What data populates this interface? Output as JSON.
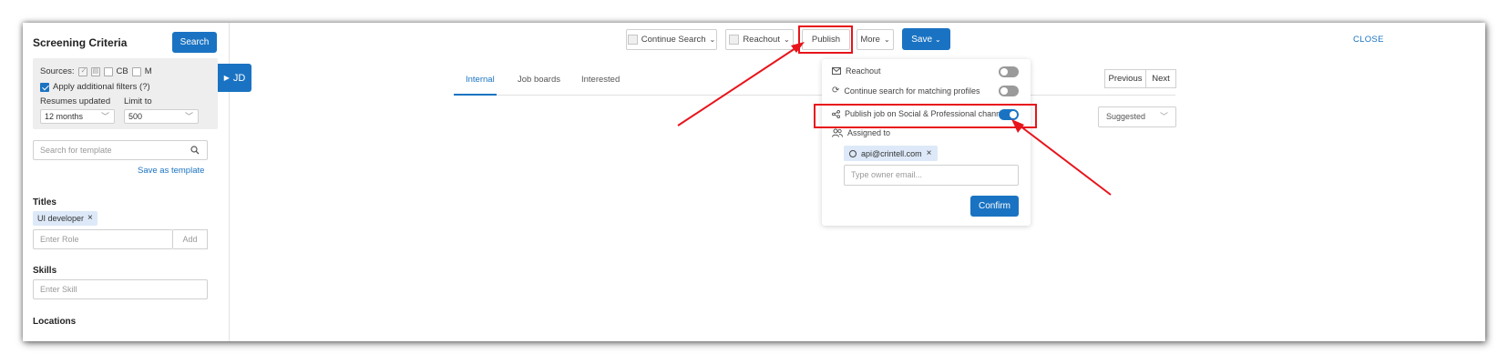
{
  "sidebar": {
    "title": "Screening Criteria",
    "search_button": "Search",
    "sources_label": "Sources:",
    "source_cb": "CB",
    "source_m": "M",
    "apply_filters_label": "Apply additional filters (?)",
    "resumes_updated_label": "Resumes updated",
    "resumes_updated_value": "12 months",
    "limit_label": "Limit to",
    "limit_value": "500",
    "template_search_placeholder": "Search for template",
    "save_template_link": "Save as template",
    "titles_label": "Titles",
    "title_chip": "UI developer",
    "role_placeholder": "Enter Role",
    "add_button": "Add",
    "skills_label": "Skills",
    "skill_placeholder": "Enter Skill",
    "locations_label": "Locations"
  },
  "toolbar": {
    "continue_search": "Continue Search",
    "reachout": "Reachout",
    "publish": "Publish",
    "more": "More",
    "save": "Save",
    "close": "CLOSE"
  },
  "jd_tab": "JD",
  "tabs": [
    {
      "label": "Internal",
      "active": true
    },
    {
      "label": "Job boards",
      "active": false
    },
    {
      "label": "Interested",
      "active": false
    }
  ],
  "pager": {
    "previous": "Previous",
    "next": "Next"
  },
  "sort_value": "Suggested",
  "dropdown": {
    "reachout_label": "Reachout",
    "reachout_on": false,
    "continue_label": "Continue search for matching profiles",
    "continue_on": false,
    "publish_label": "Publish job on Social & Professional channels",
    "publish_on": true,
    "assigned_label": "Assigned to",
    "owner_email": "api@crintell.com",
    "owner_placeholder": "Type owner email...",
    "confirm_button": "Confirm"
  },
  "colors": {
    "accent": "#1a73c2",
    "annotation": "#e8141b",
    "chip_bg": "#dde9f8"
  }
}
